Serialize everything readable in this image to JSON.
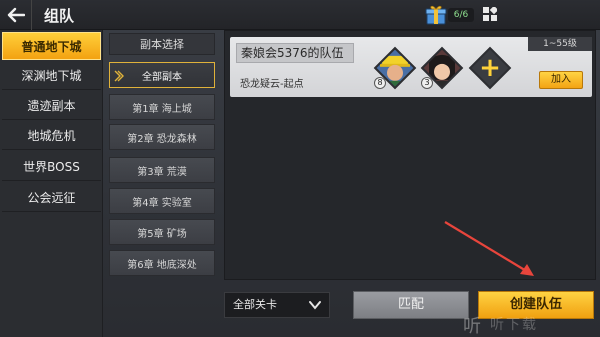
{
  "header": {
    "title": "组队",
    "gift_count": "6/6"
  },
  "nav": {
    "items": [
      {
        "label": "普通地下城",
        "active": true
      },
      {
        "label": "深渊地下城",
        "active": false
      },
      {
        "label": "遗迹副本",
        "active": false
      },
      {
        "label": "地城危机",
        "active": false
      },
      {
        "label": "世界BOSS",
        "active": false
      },
      {
        "label": "公会远征",
        "active": false
      }
    ]
  },
  "sub": {
    "header": "副本选择",
    "items": [
      {
        "label": "全部副本",
        "selected": true
      },
      {
        "label": "第1章 海上城",
        "selected": false
      },
      {
        "label": "第2章 恐龙森林",
        "selected": false
      },
      {
        "label": "第3章 荒漠",
        "selected": false
      },
      {
        "label": "第4章 实验室",
        "selected": false
      },
      {
        "label": "第5章 矿场",
        "selected": false
      },
      {
        "label": "第6章 地底深处",
        "selected": false
      }
    ]
  },
  "team": {
    "name": "秦娘会5376的队伍",
    "location": "恐龙疑云-起点",
    "level_range": "1~55级",
    "members": [
      {
        "level": "8"
      },
      {
        "level": "3"
      }
    ],
    "add_symbol": "+",
    "join_label": "加入"
  },
  "bottom": {
    "dropdown_value": "全部关卡",
    "match_label": "匹配",
    "create_label": "创建队伍"
  },
  "watermark": {
    "logo": "听",
    "text": "听下载"
  },
  "colors": {
    "accent": "#f3a211",
    "arrow": "#e8453c"
  }
}
